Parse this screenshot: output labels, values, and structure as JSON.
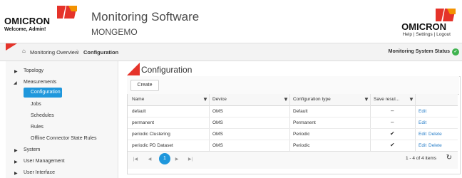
{
  "header": {
    "brand": "OMICRON",
    "welcome": "Welcome, Admin!",
    "title": "Monitoring Software",
    "subtitle": "MONGEMO",
    "right_brand": "OMICRON",
    "links": [
      "Help",
      "Settings",
      "Logout"
    ],
    "link_sep": " | "
  },
  "breadcrumb": {
    "home": "Monitoring Overview",
    "current": "Configuration"
  },
  "status": {
    "label": "Monitoring System Status",
    "icon": "check-circle-icon",
    "color": "#3fb34f"
  },
  "sidebar": {
    "items": [
      {
        "label": "Topology"
      },
      {
        "label": "Measurements"
      },
      {
        "label": "Configuration"
      },
      {
        "label": "Jobs"
      },
      {
        "label": "Schedules"
      },
      {
        "label": "Rules"
      },
      {
        "label": "Offline Connector State Rules"
      },
      {
        "label": "System"
      },
      {
        "label": "User Management"
      },
      {
        "label": "User Interface"
      }
    ]
  },
  "page": {
    "title": "Configuration",
    "create_label": "Create"
  },
  "table": {
    "columns": [
      "Name",
      "Device",
      "Configuration type",
      "Save resul..."
    ],
    "rows": [
      {
        "name": "default",
        "device": "OMS",
        "type": "Default",
        "save": "–",
        "actions": [
          "Edit"
        ]
      },
      {
        "name": "permanent",
        "device": "OMS",
        "type": "Permanent",
        "save": "–",
        "actions": [
          "Edit"
        ]
      },
      {
        "name": "periodic Clustering",
        "device": "OMS",
        "type": "Periodic",
        "save": "✔",
        "actions": [
          "Edit",
          "Delete"
        ]
      },
      {
        "name": "periodic PD Dataset",
        "device": "OMS",
        "type": "Periodic",
        "save": "✔",
        "actions": [
          "Edit",
          "Delete"
        ]
      }
    ]
  },
  "pager": {
    "current_page": "1",
    "summary": "1 - 4 of 4 items"
  },
  "colors": {
    "accent": "#1f97dc",
    "brand_red": "#e5332a",
    "brand_orange": "#f39200"
  }
}
